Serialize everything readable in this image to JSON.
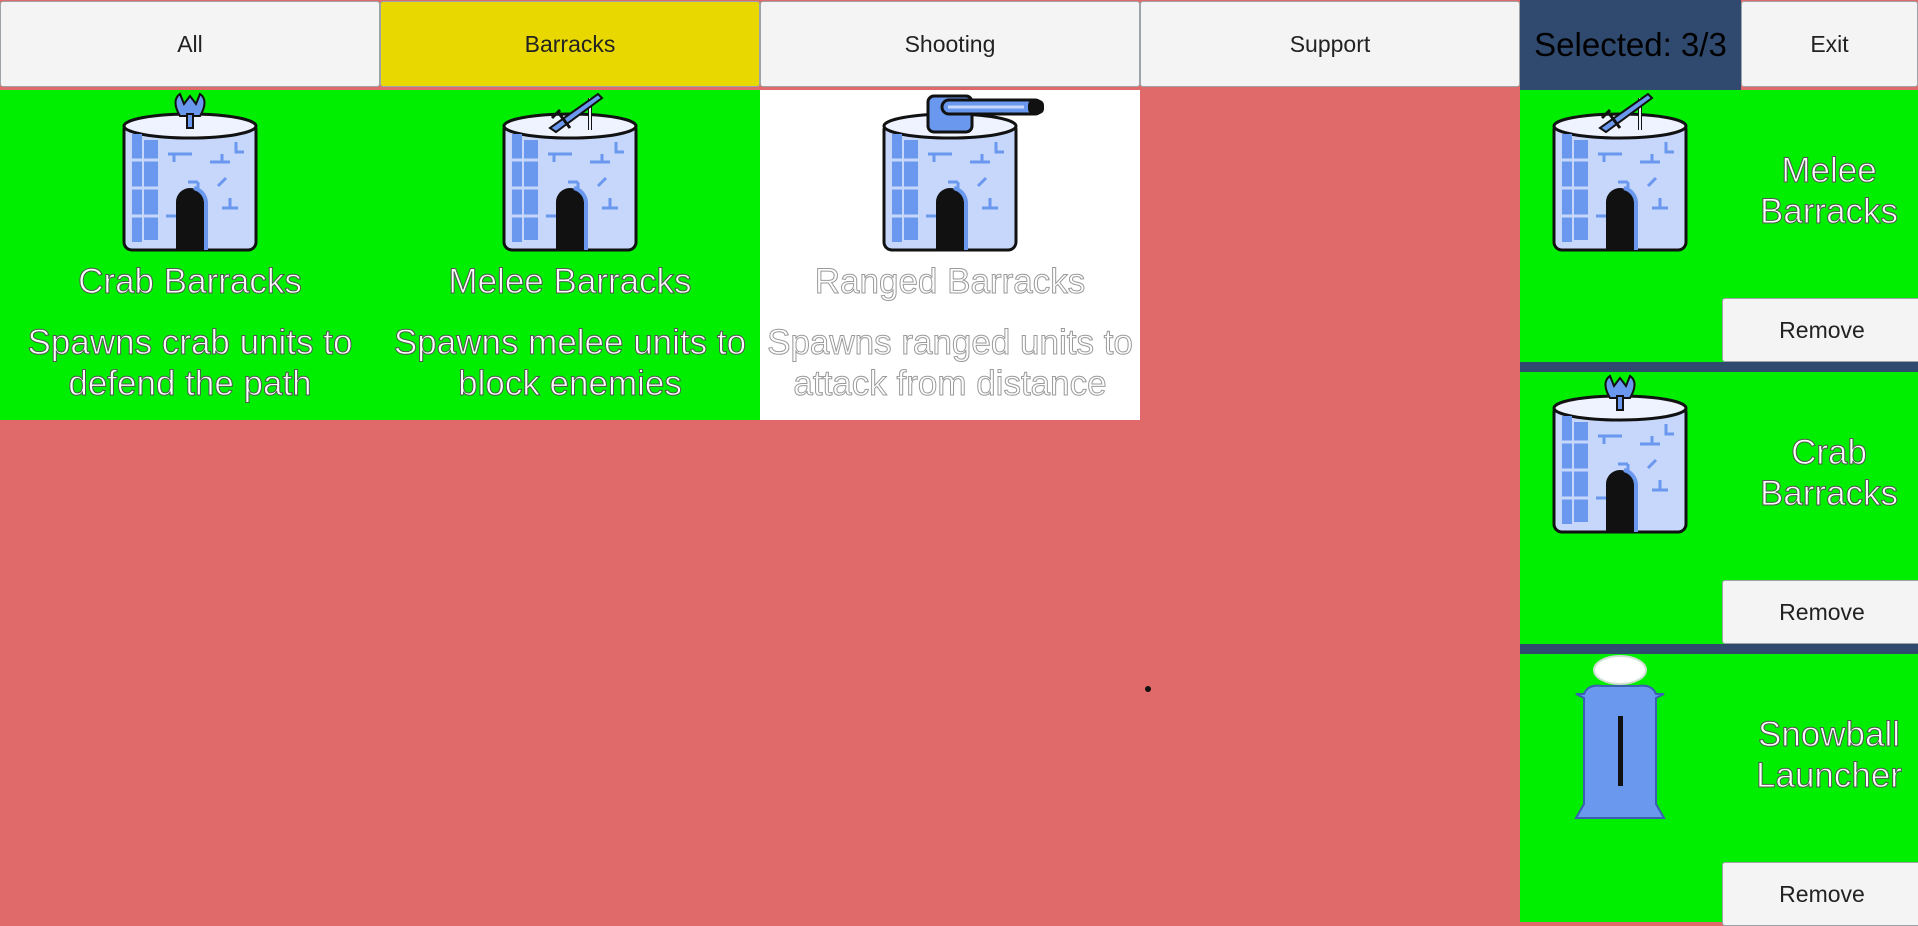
{
  "tabs": {
    "all": "All",
    "barracks": "Barracks",
    "shooting": "Shooting",
    "support": "Support"
  },
  "header": {
    "selected_counter": "Selected: 3/3",
    "exit_label": "Exit"
  },
  "cards": [
    {
      "name": "Crab Barracks",
      "desc": "Spawns crab units to defend the path",
      "icon": "crab-barracks-icon",
      "state": "available"
    },
    {
      "name": "Melee Barracks",
      "desc": "Spawns melee units to block enemies",
      "icon": "melee-barracks-icon",
      "state": "available"
    },
    {
      "name": "Ranged Barracks",
      "desc": "Spawns ranged units to attack from distance",
      "icon": "ranged-barracks-icon",
      "state": "disabled"
    }
  ],
  "selected": [
    {
      "name": "Melee Barracks",
      "remove_label": "Remove",
      "icon": "melee-barracks-icon"
    },
    {
      "name": "Crab Barracks",
      "remove_label": "Remove",
      "icon": "crab-barracks-icon"
    },
    {
      "name": "Snowball Launcher",
      "remove_label": "Remove",
      "icon": "snowball-launcher-icon"
    }
  ],
  "colors": {
    "background": "#e06a6a",
    "available_card": "#00ee00",
    "disabled_card": "#ffffff",
    "active_tab": "#e8d800",
    "sidebar": "#2f4a6e"
  }
}
